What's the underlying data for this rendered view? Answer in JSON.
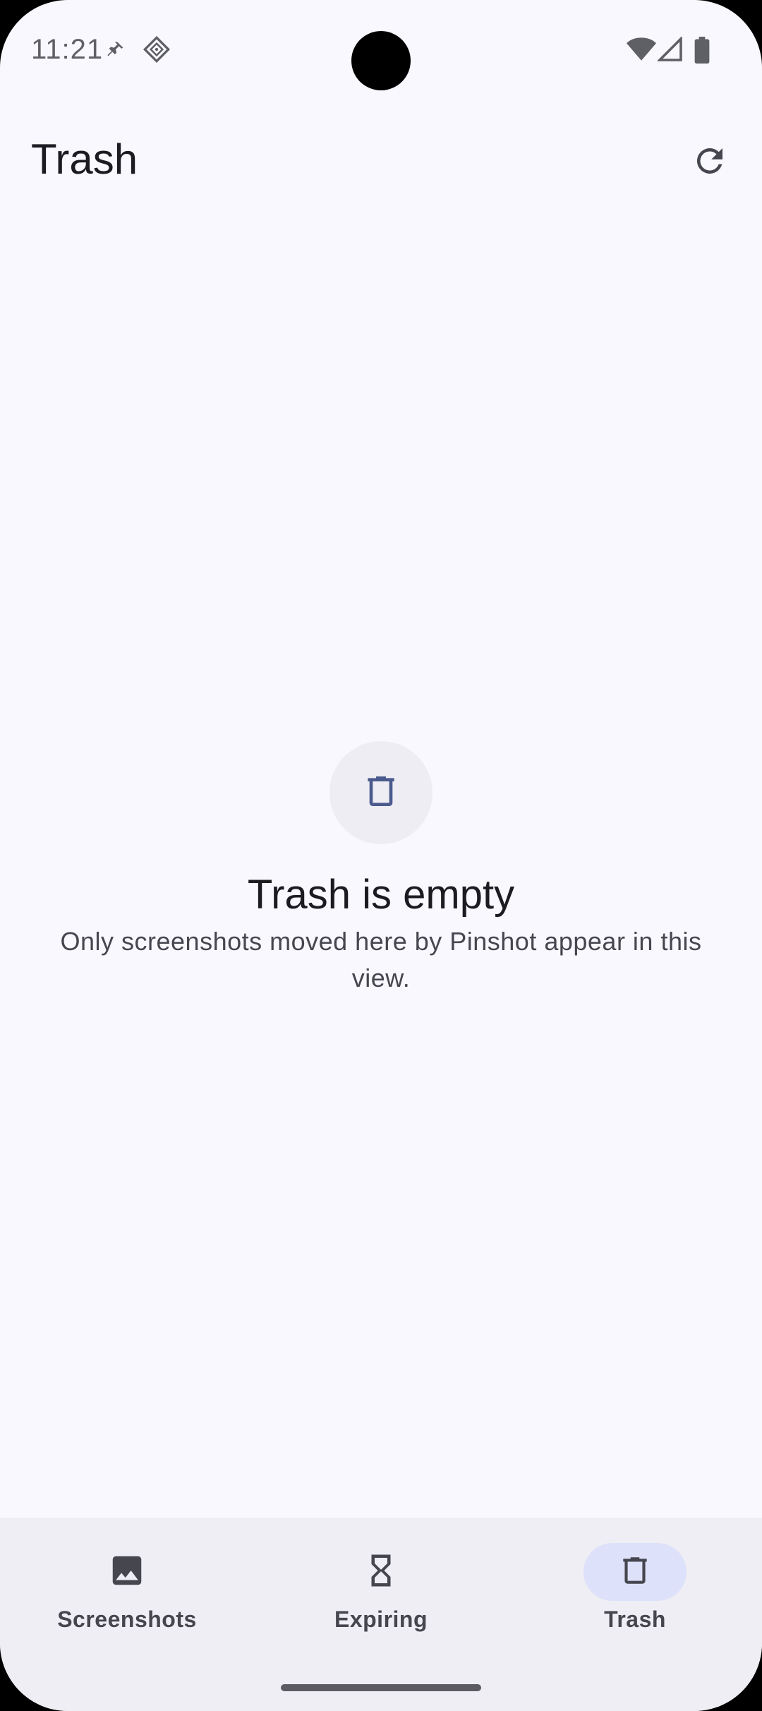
{
  "status_bar": {
    "time": "11:21",
    "icons": [
      "pin-icon",
      "app-notification-icon",
      "wifi-icon",
      "signal-icon",
      "battery-icon"
    ]
  },
  "app_bar": {
    "title": "Trash",
    "action_icon": "refresh-icon"
  },
  "empty_state": {
    "icon": "trash-icon",
    "title": "Trash is empty",
    "subtitle": "Only screenshots moved here by Pinshot appear in this view."
  },
  "bottom_nav": {
    "items": [
      {
        "label": "Screenshots",
        "icon": "image-icon",
        "selected": false
      },
      {
        "label": "Expiring",
        "icon": "hourglass-icon",
        "selected": false
      },
      {
        "label": "Trash",
        "icon": "trash-icon",
        "selected": true
      }
    ]
  },
  "colors": {
    "background": "#f9f8fe",
    "nav_background": "#efeef4",
    "active_indicator": "#dde1f9",
    "accent_icon": "#4a5a8c",
    "text_primary": "#1c1b20",
    "text_secondary": "#46464f"
  }
}
